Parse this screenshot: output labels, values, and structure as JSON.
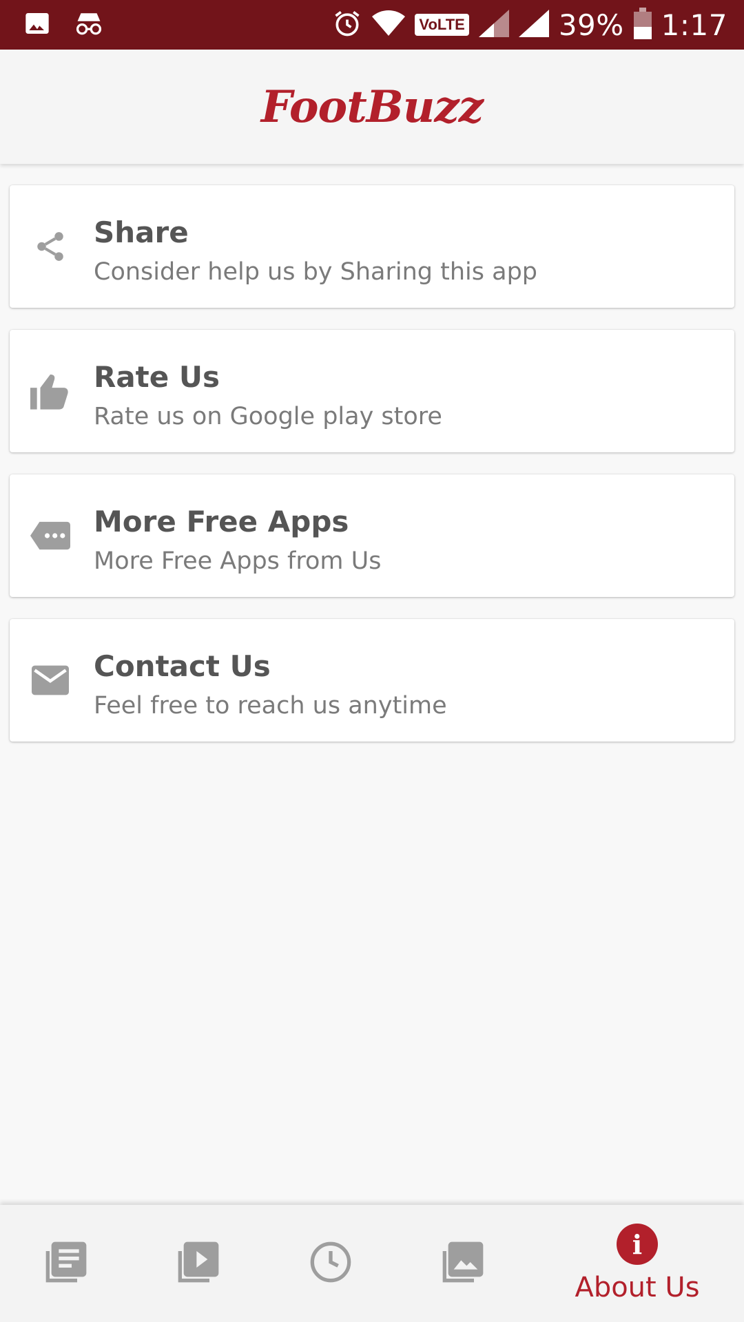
{
  "status_bar": {
    "battery": "39%",
    "time": "1:17",
    "network_badge": "VoLTE",
    "icons": [
      "image-icon",
      "incognito-icon",
      "alarm-icon",
      "wifi-icon",
      "signal-icon",
      "battery-icon"
    ]
  },
  "header": {
    "logo_text": "FootBuzz"
  },
  "menu": [
    {
      "title": "Share",
      "subtitle": "Consider help us by Sharing this app",
      "icon": "share-icon"
    },
    {
      "title": "Rate Us",
      "subtitle": "Rate us on Google play store",
      "icon": "thumbs-up-icon"
    },
    {
      "title": "More Free Apps",
      "subtitle": "More Free Apps from Us",
      "icon": "tag-icon"
    },
    {
      "title": "Contact Us",
      "subtitle": "Feel free to reach us anytime",
      "icon": "mail-icon"
    }
  ],
  "bottom_nav": {
    "items": [
      "news-icon",
      "videos-icon",
      "history-icon",
      "gallery-icon",
      "info-icon"
    ],
    "active_label": "About Us"
  },
  "colors": {
    "status_bar": "#72141a",
    "accent": "#b2202b",
    "icon_gray": "#9e9e9e"
  }
}
